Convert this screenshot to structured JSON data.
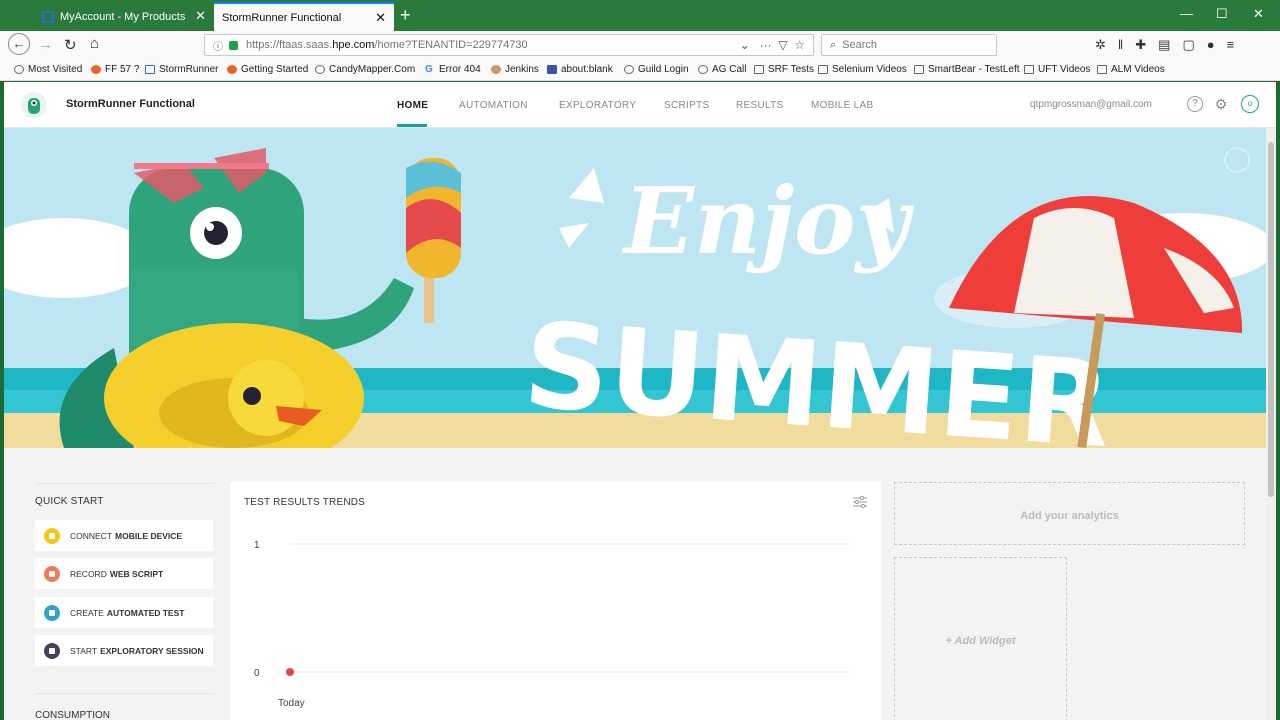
{
  "browser": {
    "tabs": [
      {
        "label": "MyAccount - My Products",
        "active": false
      },
      {
        "label": "StormRunner Functional",
        "active": true
      }
    ],
    "url": {
      "prefix": "https://ftaas.saas.",
      "host": "hpe.com",
      "path": "/home?TENANTID=229774730"
    },
    "search_placeholder": "Search",
    "bookmarks": [
      "Most Visited",
      "FF 57 ?",
      "StormRunner",
      "Getting Started",
      "CandyMapper.Com",
      "Error 404",
      "Jenkins",
      "about:blank",
      "Guild Login",
      "AG Call",
      "SRF Tests",
      "Selenium Videos",
      "SmartBear - TestLeft",
      "UFT Videos",
      "ALM Videos"
    ]
  },
  "app": {
    "name": "StormRunner Functional",
    "nav": [
      "HOME",
      "AUTOMATION",
      "EXPLORATORY",
      "SCRIPTS",
      "RESULTS",
      "MOBILE LAB"
    ],
    "active_nav": "HOME",
    "user_email": "qtpmgrossman@gmail.com",
    "accent_color": "#1aa39a"
  },
  "banner": {
    "headline_1": "Enjoy",
    "headline_2": "SUMMER"
  },
  "quick_start": {
    "title": "QUICK START",
    "items": [
      {
        "prefix": "CONNECT",
        "bold": "MOBILE DEVICE",
        "color": "#f5c518"
      },
      {
        "prefix": "RECORD",
        "bold": "WEB SCRIPT",
        "color": "#ef7b5a"
      },
      {
        "prefix": "CREATE",
        "bold": "AUTOMATED TEST",
        "color": "#2fa3c7"
      },
      {
        "prefix": "START",
        "bold": "EXPLORATORY SESSION",
        "color": "#4b3f5c"
      }
    ],
    "next_section": "CONSUMPTION"
  },
  "test_results": {
    "title": "TEST RESULTS TRENDS"
  },
  "chart_data": {
    "type": "line",
    "title": "TEST RESULTS TRENDS",
    "categories": [
      "Today"
    ],
    "series": [
      {
        "values": [
          0
        ],
        "color": "#e04848"
      }
    ],
    "ylim": [
      0,
      1
    ],
    "yticks": [
      0,
      1
    ],
    "grid": true
  },
  "widgets": {
    "analytics_label": "Add your analytics",
    "add_widget_label": "+ Add Widget"
  }
}
